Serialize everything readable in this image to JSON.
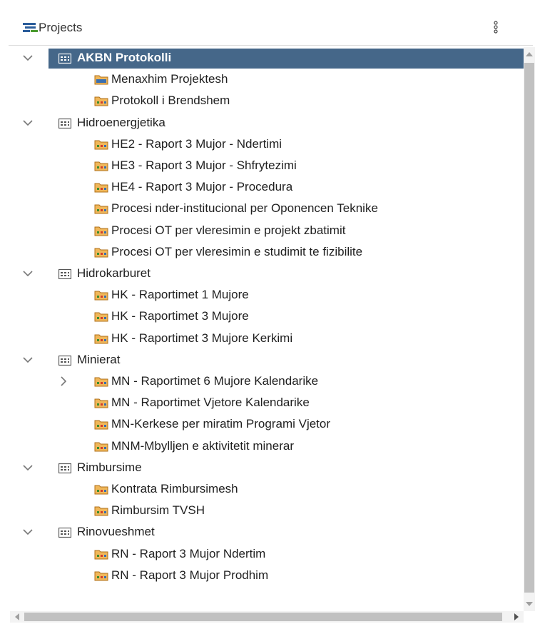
{
  "header": {
    "title": "Projects",
    "icon": "gantt-icon",
    "menu_icon": "more-vertical-icon"
  },
  "tree": [
    {
      "label": "AKBN Protokolli",
      "level": 0,
      "kind": "group",
      "expanded": true,
      "selected": true
    },
    {
      "label": "Menaxhim Projektesh",
      "level": 1,
      "kind": "project-alt"
    },
    {
      "label": "Protokoll i Brendshem",
      "level": 1,
      "kind": "project"
    },
    {
      "label": "Hidroenergjetika",
      "level": 0,
      "kind": "group",
      "expanded": true
    },
    {
      "label": "HE2 - Raport 3 Mujor - Ndertimi",
      "level": 1,
      "kind": "project"
    },
    {
      "label": "HE3 - Raport 3 Mujor - Shfrytezimi",
      "level": 1,
      "kind": "project"
    },
    {
      "label": "HE4 - Raport 3 Mujor - Procedura",
      "level": 1,
      "kind": "project"
    },
    {
      "label": "Procesi nder-institucional per Oponencen Teknike",
      "level": 1,
      "kind": "project"
    },
    {
      "label": "Procesi OT per vleresimin e projekt zbatimit",
      "level": 1,
      "kind": "project"
    },
    {
      "label": "Procesi OT per vleresimin e studimit te fizibilite",
      "level": 1,
      "kind": "project"
    },
    {
      "label": "Hidrokarburet",
      "level": 0,
      "kind": "group",
      "expanded": true
    },
    {
      "label": "HK - Raportimet 1 Mujore",
      "level": 1,
      "kind": "project"
    },
    {
      "label": "HK - Raportimet 3 Mujore",
      "level": 1,
      "kind": "project"
    },
    {
      "label": "HK - Raportimet 3 Mujore Kerkimi",
      "level": 1,
      "kind": "project"
    },
    {
      "label": "Minierat",
      "level": 0,
      "kind": "group",
      "expanded": true
    },
    {
      "label": "MN - Raportimet 6 Mujore Kalendarike",
      "level": 1,
      "kind": "project",
      "collapsed_child": true
    },
    {
      "label": "MN - Raportimet Vjetore Kalendarike",
      "level": 1,
      "kind": "project"
    },
    {
      "label": "MN-Kerkese per miratim Programi Vjetor",
      "level": 1,
      "kind": "project"
    },
    {
      "label": "MNM-Mbylljen e aktivitetit minerar",
      "level": 1,
      "kind": "project"
    },
    {
      "label": "Rimbursime",
      "level": 0,
      "kind": "group",
      "expanded": true
    },
    {
      "label": "Kontrata Rimbursimesh",
      "level": 1,
      "kind": "project"
    },
    {
      "label": "Rimbursim TVSH",
      "level": 1,
      "kind": "project"
    },
    {
      "label": "Rinovueshmet",
      "level": 0,
      "kind": "group",
      "expanded": true
    },
    {
      "label": "RN - Raport 3 Mujor Ndertim",
      "level": 1,
      "kind": "project"
    },
    {
      "label": "RN - Raport 3 Mujor Prodhim",
      "level": 1,
      "kind": "project"
    }
  ],
  "colors": {
    "selected_bg": "#456789",
    "folder": "#e8a33b",
    "folder_dark": "#b0701a"
  }
}
